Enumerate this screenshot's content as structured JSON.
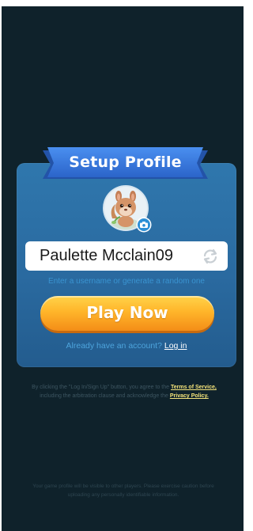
{
  "colors": {
    "background": "#0f222b",
    "card": "#2a6aa0",
    "ribbon": "#3273d6",
    "play_button": "#ffb52a",
    "hint": "#3a93d0",
    "link_yellow": "#f3e37a"
  },
  "header": {
    "title": "Setup Profile"
  },
  "profile": {
    "avatar_icon": "squirrel-avatar",
    "camera_icon": "camera-icon"
  },
  "username": {
    "value": "Paulette Mcclain09",
    "placeholder": "",
    "refresh_icon": "refresh-icon",
    "hint": "Enter a username or generate a random one"
  },
  "actions": {
    "play_label": "Play Now",
    "login_prompt": "Already have an account?",
    "login_link": "Log in"
  },
  "legal": {
    "text_1": "By clicking the \"Log In/Sign Up\" button, you agree to the",
    "terms_link": "Terms of Service,",
    "text_2": "including the arbitration clause and acknowledge the",
    "privacy_link": "Privacy Policy."
  },
  "footer": {
    "note": "Your game profile will be visible to other players. Please exercise caution before uploading any personally identifiable information."
  }
}
